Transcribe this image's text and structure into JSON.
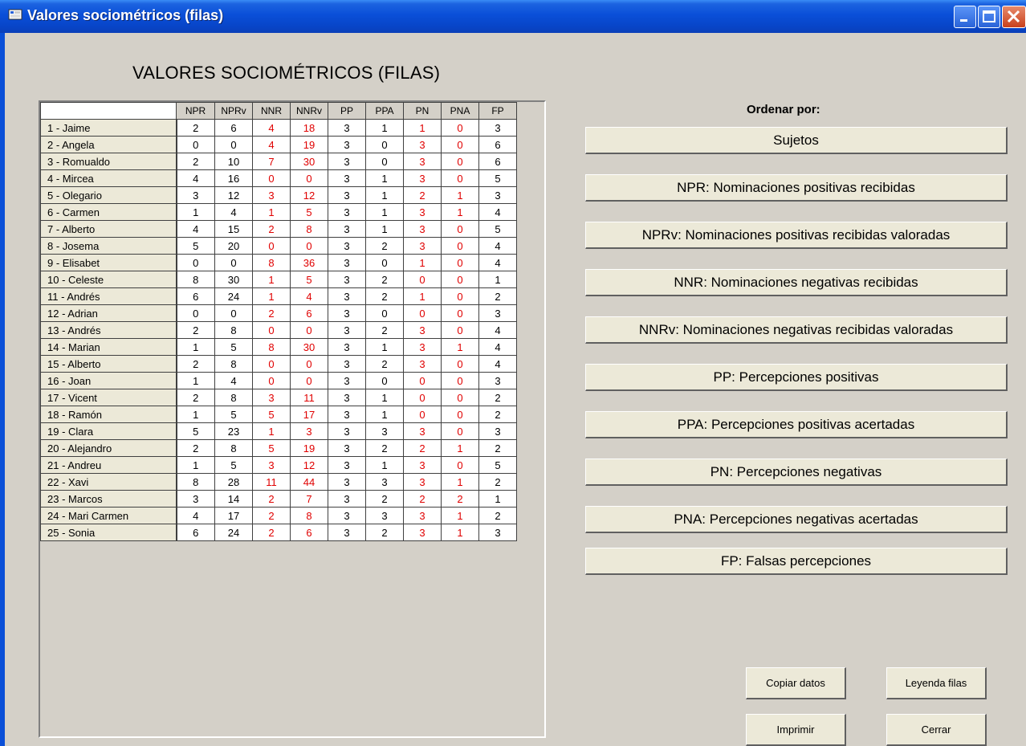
{
  "window": {
    "title": "Valores sociométricos (filas)"
  },
  "heading": "VALORES SOCIOMÉTRICOS (FILAS)",
  "columns": [
    "NPR",
    "NPRv",
    "NNR",
    "NNRv",
    "PP",
    "PPA",
    "PN",
    "PNA",
    "FP"
  ],
  "red_columns": [
    2,
    3,
    6,
    7
  ],
  "rows": [
    {
      "name": "1 - Jaime",
      "values": [
        "2",
        "6",
        "4",
        "18",
        "3",
        "1",
        "1",
        "0",
        "3"
      ]
    },
    {
      "name": "2 - Angela",
      "values": [
        "0",
        "0",
        "4",
        "19",
        "3",
        "0",
        "3",
        "0",
        "6"
      ]
    },
    {
      "name": "3 - Romualdo",
      "values": [
        "2",
        "10",
        "7",
        "30",
        "3",
        "0",
        "3",
        "0",
        "6"
      ]
    },
    {
      "name": "4 - Mircea",
      "values": [
        "4",
        "16",
        "0",
        "0",
        "3",
        "1",
        "3",
        "0",
        "5"
      ]
    },
    {
      "name": "5 - Olegario",
      "values": [
        "3",
        "12",
        "3",
        "12",
        "3",
        "1",
        "2",
        "1",
        "3"
      ]
    },
    {
      "name": "6 - Carmen",
      "values": [
        "1",
        "4",
        "1",
        "5",
        "3",
        "1",
        "3",
        "1",
        "4"
      ]
    },
    {
      "name": "7 - Alberto",
      "values": [
        "4",
        "15",
        "2",
        "8",
        "3",
        "1",
        "3",
        "0",
        "5"
      ]
    },
    {
      "name": "8 - Josema",
      "values": [
        "5",
        "20",
        "0",
        "0",
        "3",
        "2",
        "3",
        "0",
        "4"
      ]
    },
    {
      "name": "9 - Elisabet",
      "values": [
        "0",
        "0",
        "8",
        "36",
        "3",
        "0",
        "1",
        "0",
        "4"
      ]
    },
    {
      "name": "10 - Celeste",
      "values": [
        "8",
        "30",
        "1",
        "5",
        "3",
        "2",
        "0",
        "0",
        "1"
      ]
    },
    {
      "name": "11 - Andrés",
      "values": [
        "6",
        "24",
        "1",
        "4",
        "3",
        "2",
        "1",
        "0",
        "2"
      ]
    },
    {
      "name": "12 - Adrian",
      "values": [
        "0",
        "0",
        "2",
        "6",
        "3",
        "0",
        "0",
        "0",
        "3"
      ]
    },
    {
      "name": "13 - Andrés",
      "values": [
        "2",
        "8",
        "0",
        "0",
        "3",
        "2",
        "3",
        "0",
        "4"
      ]
    },
    {
      "name": "14 - Marian",
      "values": [
        "1",
        "5",
        "8",
        "30",
        "3",
        "1",
        "3",
        "1",
        "4"
      ]
    },
    {
      "name": "15 - Alberto",
      "values": [
        "2",
        "8",
        "0",
        "0",
        "3",
        "2",
        "3",
        "0",
        "4"
      ]
    },
    {
      "name": "16 - Joan",
      "values": [
        "1",
        "4",
        "0",
        "0",
        "3",
        "0",
        "0",
        "0",
        "3"
      ]
    },
    {
      "name": "17 - Vicent",
      "values": [
        "2",
        "8",
        "3",
        "11",
        "3",
        "1",
        "0",
        "0",
        "2"
      ]
    },
    {
      "name": "18 - Ramón",
      "values": [
        "1",
        "5",
        "5",
        "17",
        "3",
        "1",
        "0",
        "0",
        "2"
      ]
    },
    {
      "name": "19 - Clara",
      "values": [
        "5",
        "23",
        "1",
        "3",
        "3",
        "3",
        "3",
        "0",
        "3"
      ]
    },
    {
      "name": "20 - Alejandro",
      "values": [
        "2",
        "8",
        "5",
        "19",
        "3",
        "2",
        "2",
        "1",
        "2"
      ]
    },
    {
      "name": "21 - Andreu",
      "values": [
        "1",
        "5",
        "3",
        "12",
        "3",
        "1",
        "3",
        "0",
        "5"
      ]
    },
    {
      "name": "22 - Xavi",
      "values": [
        "8",
        "28",
        "11",
        "44",
        "3",
        "3",
        "3",
        "1",
        "2"
      ]
    },
    {
      "name": "23 - Marcos",
      "values": [
        "3",
        "14",
        "2",
        "7",
        "3",
        "2",
        "2",
        "2",
        "1"
      ]
    },
    {
      "name": "24 - Mari Carmen",
      "values": [
        "4",
        "17",
        "2",
        "8",
        "3",
        "3",
        "3",
        "1",
        "2"
      ]
    },
    {
      "name": "25 - Sonia",
      "values": [
        "6",
        "24",
        "2",
        "6",
        "3",
        "2",
        "3",
        "1",
        "3"
      ]
    }
  ],
  "order": {
    "label": "Ordenar por:",
    "buttons": [
      "Sujetos",
      "NPR: Nominaciones positivas recibidas",
      "NPRv: Nominaciones positivas recibidas valoradas",
      "NNR:  Nominaciones negativas recibidas",
      "NNRv:  Nominaciones negativas recibidas valoradas",
      "PP:  Percepciones positivas",
      "PPA:  Percepciones positivas acertadas",
      "PN: Percepciones negativas",
      "PNA:  Percepciones negativas acertadas",
      "FP:  Falsas percepciones"
    ]
  },
  "actions": {
    "copy": "Copiar datos",
    "legend": "Leyenda filas",
    "print": "Imprimir",
    "close": "Cerrar"
  },
  "colors": {
    "red_value": "#e00000",
    "title_bar": "#0a4fd8",
    "background": "#d4d0c8"
  }
}
